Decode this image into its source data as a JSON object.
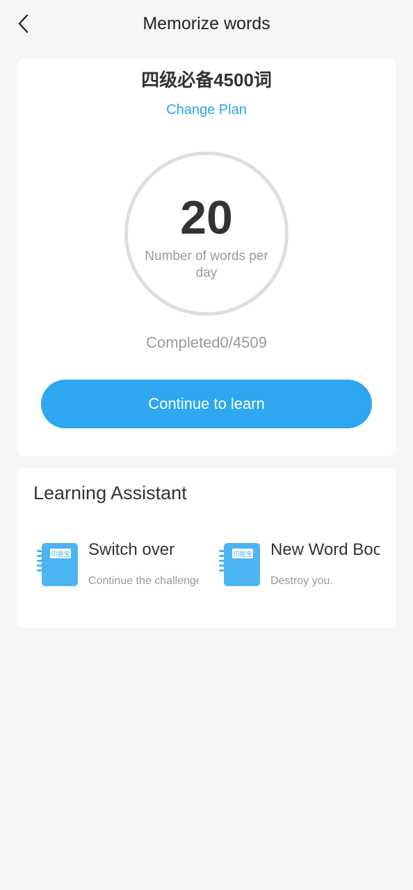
{
  "header": {
    "title": "Memorize words",
    "back_icon": "chevron-left-icon"
  },
  "plan": {
    "title": "四级必备4500词",
    "change_plan_label": "Change Plan",
    "words_per_day": "20",
    "words_per_day_label": "Number of words per day",
    "completed_text": "Completed0/4509",
    "continue_label": "Continue to learn"
  },
  "assistant": {
    "title": "Learning Assistant",
    "tools": [
      {
        "name": "Switch over",
        "description": "Continue the challenge",
        "icon": "notebook-icon",
        "icon_label": "印题宝"
      },
      {
        "name": "New Word Book",
        "description": "Destroy you.",
        "icon": "notebook-icon",
        "icon_label": "印题宝"
      }
    ]
  },
  "colors": {
    "accent": "#2ea7f0",
    "link": "#2aa4ec",
    "icon_blue": "#4db4f2",
    "background": "#f6f6f6"
  }
}
